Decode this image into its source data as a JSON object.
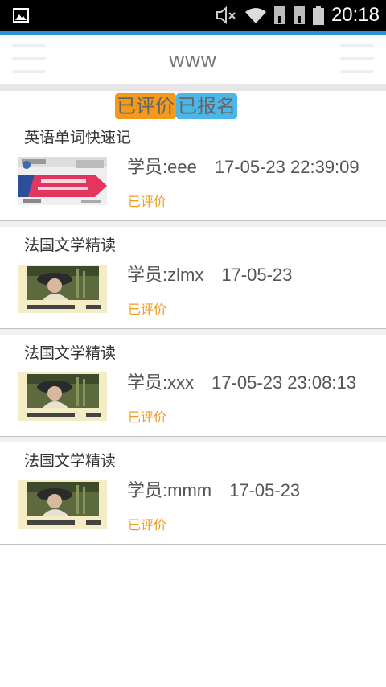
{
  "status_bar": {
    "time": "20:18"
  },
  "header": {
    "title": "www"
  },
  "tabs": [
    {
      "label": "已评价"
    },
    {
      "label": "已报名"
    }
  ],
  "items": [
    {
      "title": "英语单词快速记",
      "student": "学员:eee",
      "date": "17-05-23 22:39:09",
      "status": "已评价",
      "thumb": "english-words"
    },
    {
      "title": "法国文学精读",
      "student": "学员:zlmx",
      "date": "17-05-23",
      "status": "已评价",
      "thumb": "french-literature"
    },
    {
      "title": "法国文学精读",
      "student": "学员:xxx",
      "date": "17-05-23 23:08:13",
      "status": "已评价",
      "thumb": "french-literature"
    },
    {
      "title": "法国文学精读",
      "student": "学员:mmm",
      "date": "17-05-23",
      "status": "已评价",
      "thumb": "french-literature"
    }
  ],
  "colors": {
    "accent": "#2a93d8",
    "orange": "#f39a1c",
    "blue_tab": "#4ab7e8"
  }
}
